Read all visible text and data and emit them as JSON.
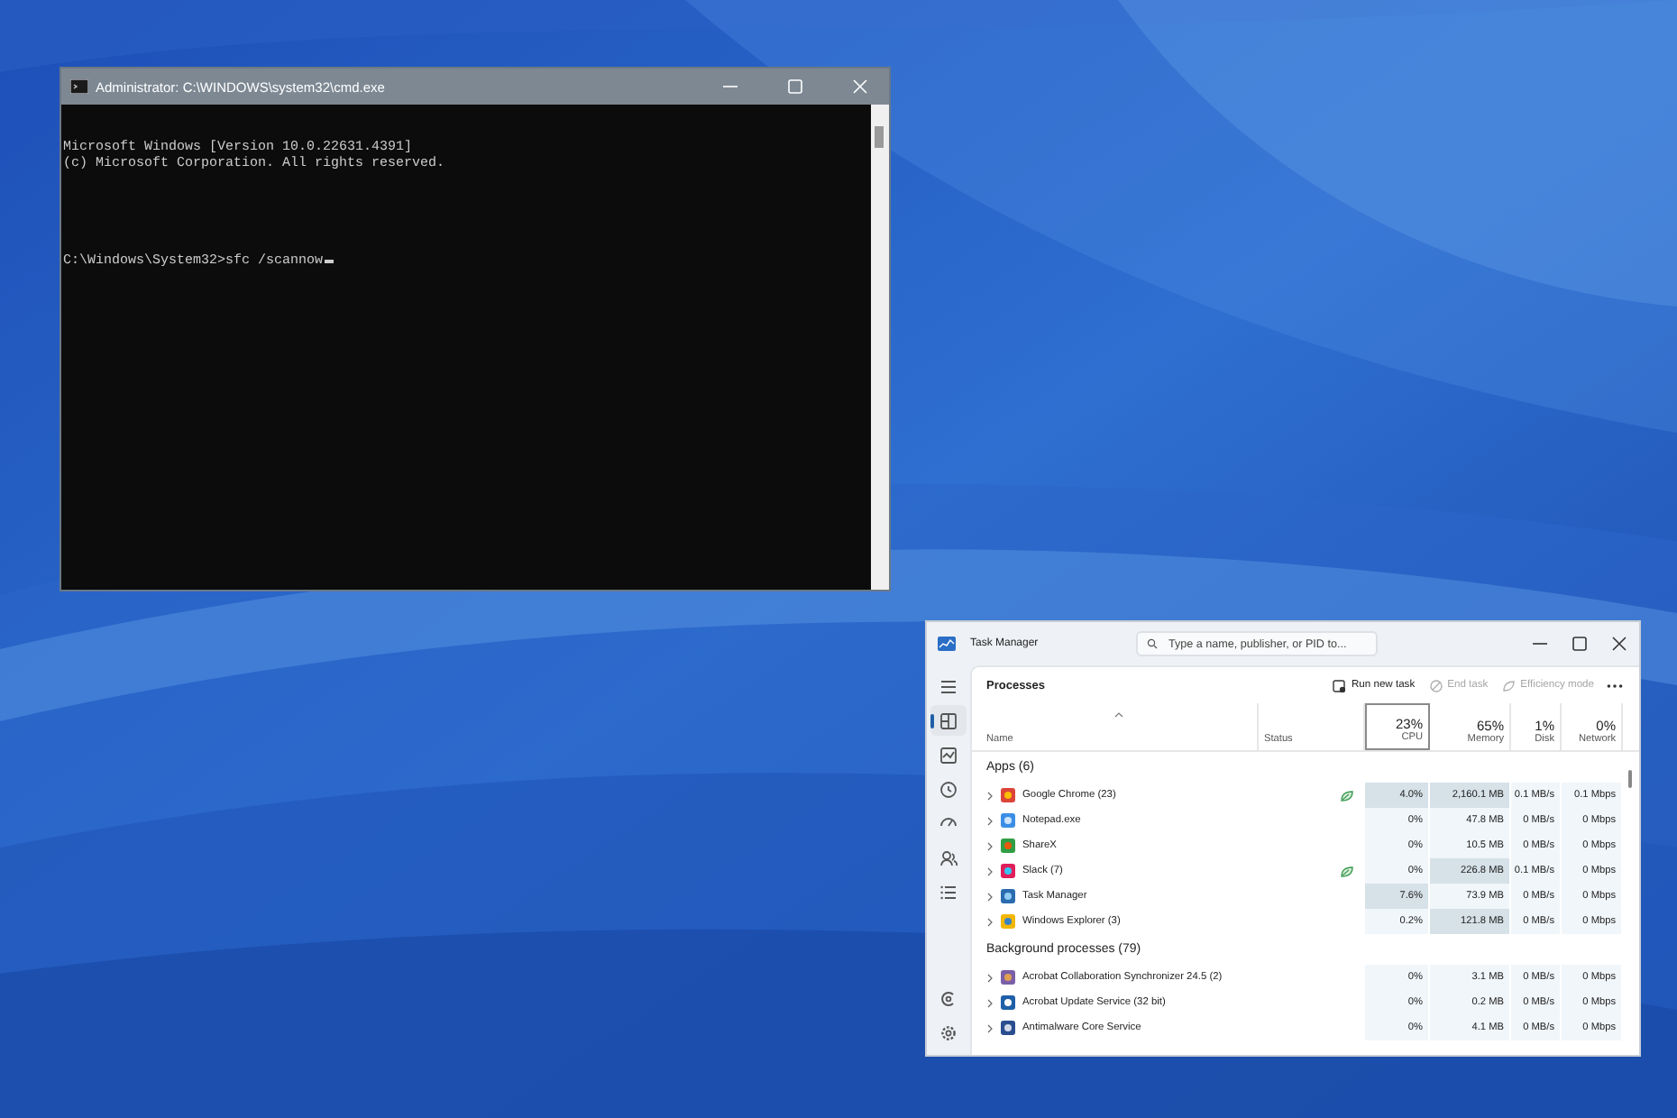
{
  "cmd_window": {
    "title": "Administrator: C:\\WINDOWS\\system32\\cmd.exe",
    "output": [
      "Microsoft Windows [Version 10.0.22631.4391]",
      "(c) Microsoft Corporation. All rights reserved."
    ],
    "prompt": "C:\\Windows\\System32>sfc /scannow"
  },
  "task_manager": {
    "title": "Task Manager",
    "search": {
      "placeholder": "Type a name, publisher, or PID to..."
    },
    "nav": [
      {
        "selected": false
      },
      {
        "selected": true
      },
      {
        "selected": false
      },
      {
        "selected": false
      },
      {
        "selected": false
      },
      {
        "selected": false
      },
      {
        "selected": false
      },
      {
        "selected": false
      }
    ],
    "page_title": "Processes",
    "toolbar": [
      {
        "label": "Run new task",
        "disabled": false
      },
      {
        "label": "End task",
        "disabled": true
      },
      {
        "label": "Efficiency mode",
        "disabled": true
      }
    ],
    "columns": [
      {
        "label": "Name",
        "selected": false
      },
      {
        "label": "Status",
        "selected": false
      },
      {
        "value": "23%",
        "label": "CPU",
        "selected": true
      },
      {
        "value": "65%",
        "label": "Memory",
        "selected": false
      },
      {
        "value": "1%",
        "label": "Disk",
        "selected": false
      },
      {
        "value": "0%",
        "label": "Network",
        "selected": false
      }
    ],
    "groups": [
      {
        "title": "Apps (6)",
        "rows": [
          {
            "name": "Google Chrome (23)",
            "efficiency": true,
            "cells": [
              {
                "text": "4.0%",
                "hot": true
              },
              {
                "text": "2,160.1 MB",
                "hot": true
              },
              {
                "text": "0.1 MB/s",
                "hot": false
              },
              {
                "text": "0.1 Mbps",
                "hot": false
              }
            ]
          },
          {
            "name": "Notepad.exe",
            "efficiency": false,
            "cells": [
              {
                "text": "0%",
                "hot": false
              },
              {
                "text": "47.8 MB",
                "hot": false
              },
              {
                "text": "0 MB/s",
                "hot": false
              },
              {
                "text": "0 Mbps",
                "hot": false
              }
            ]
          },
          {
            "name": "ShareX",
            "efficiency": false,
            "cells": [
              {
                "text": "0%",
                "hot": false
              },
              {
                "text": "10.5 MB",
                "hot": false
              },
              {
                "text": "0 MB/s",
                "hot": false
              },
              {
                "text": "0 Mbps",
                "hot": false
              }
            ]
          },
          {
            "name": "Slack (7)",
            "efficiency": true,
            "cells": [
              {
                "text": "0%",
                "hot": false
              },
              {
                "text": "226.8 MB",
                "hot": true
              },
              {
                "text": "0.1 MB/s",
                "hot": false
              },
              {
                "text": "0 Mbps",
                "hot": false
              }
            ]
          },
          {
            "name": "Task Manager",
            "efficiency": false,
            "cells": [
              {
                "text": "7.6%",
                "hot": true
              },
              {
                "text": "73.9 MB",
                "hot": false
              },
              {
                "text": "0 MB/s",
                "hot": false
              },
              {
                "text": "0 Mbps",
                "hot": false
              }
            ]
          },
          {
            "name": "Windows Explorer (3)",
            "efficiency": false,
            "cells": [
              {
                "text": "0.2%",
                "hot": false
              },
              {
                "text": "121.8 MB",
                "hot": true
              },
              {
                "text": "0 MB/s",
                "hot": false
              },
              {
                "text": "0 Mbps",
                "hot": false
              }
            ]
          }
        ]
      },
      {
        "title": "Background processes (79)",
        "rows": [
          {
            "name": "Acrobat Collaboration Synchronizer 24.5 (2)",
            "efficiency": false,
            "cells": [
              {
                "text": "0%",
                "hot": false
              },
              {
                "text": "3.1 MB",
                "hot": false
              },
              {
                "text": "0 MB/s",
                "hot": false
              },
              {
                "text": "0 Mbps",
                "hot": false
              }
            ]
          },
          {
            "name": "Acrobat Update Service (32 bit)",
            "efficiency": false,
            "cells": [
              {
                "text": "0%",
                "hot": false
              },
              {
                "text": "0.2 MB",
                "hot": false
              },
              {
                "text": "0 MB/s",
                "hot": false
              },
              {
                "text": "0 Mbps",
                "hot": false
              }
            ]
          },
          {
            "name": "Antimalware Core Service",
            "efficiency": false,
            "cells": [
              {
                "text": "0%",
                "hot": false
              },
              {
                "text": "4.1 MB",
                "hot": false
              },
              {
                "text": "0 MB/s",
                "hot": false
              },
              {
                "text": "0 Mbps",
                "hot": false
              }
            ]
          }
        ]
      }
    ]
  }
}
